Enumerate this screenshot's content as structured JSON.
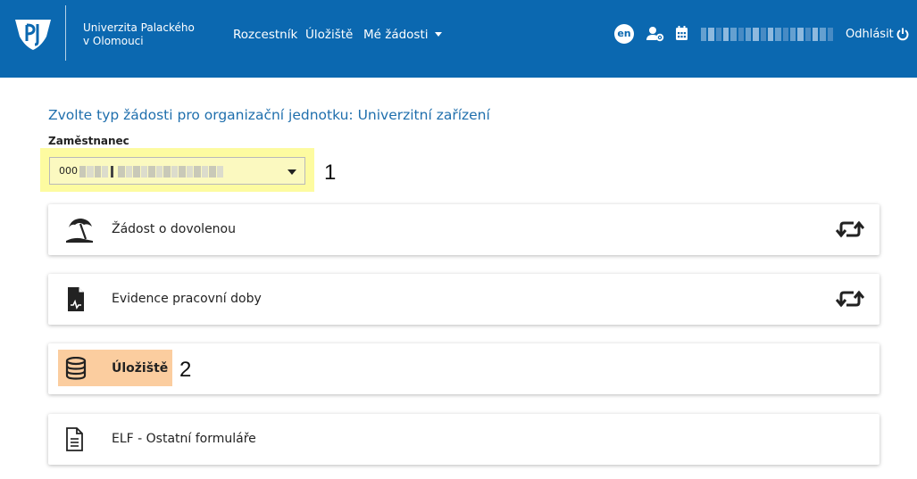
{
  "header": {
    "university_name_line1": "Univerzita Palackého",
    "university_name_line2": "v Olomouci",
    "nav": [
      {
        "label": "Rozcestník"
      },
      {
        "label": "Úložiště"
      },
      {
        "label": "Mé žádosti"
      }
    ],
    "language": "en",
    "logout_label": "Odhlásit",
    "icons": [
      "user-settings-icon",
      "calendar-icon",
      "power-icon"
    ]
  },
  "main": {
    "title": "Zvolte typ žádosti pro organizační jednotku: Univerzitní zařízení",
    "employee_label": "Zaměstnanec",
    "employee_value_prefix": "000"
  },
  "annotations": {
    "step1": "1",
    "step2": "2"
  },
  "cards": [
    {
      "title": "Žádost o dovolenou",
      "icon": "beach-umbrella-icon",
      "sync_icon": true
    },
    {
      "title": "Evidence pracovní doby",
      "icon": "time-sheet-icon",
      "sync_icon": true
    },
    {
      "title": "Úložiště",
      "icon": "database-icon",
      "sync_icon": false
    },
    {
      "title": "ELF - Ostatní formuláře",
      "icon": "document-icon",
      "sync_icon": false
    }
  ],
  "colors": {
    "header_bg": "#0b68b0",
    "title_blue": "#1f6fad",
    "highlight_yellow": "#fdfba0",
    "highlight_orange": "#fbcd9f"
  }
}
